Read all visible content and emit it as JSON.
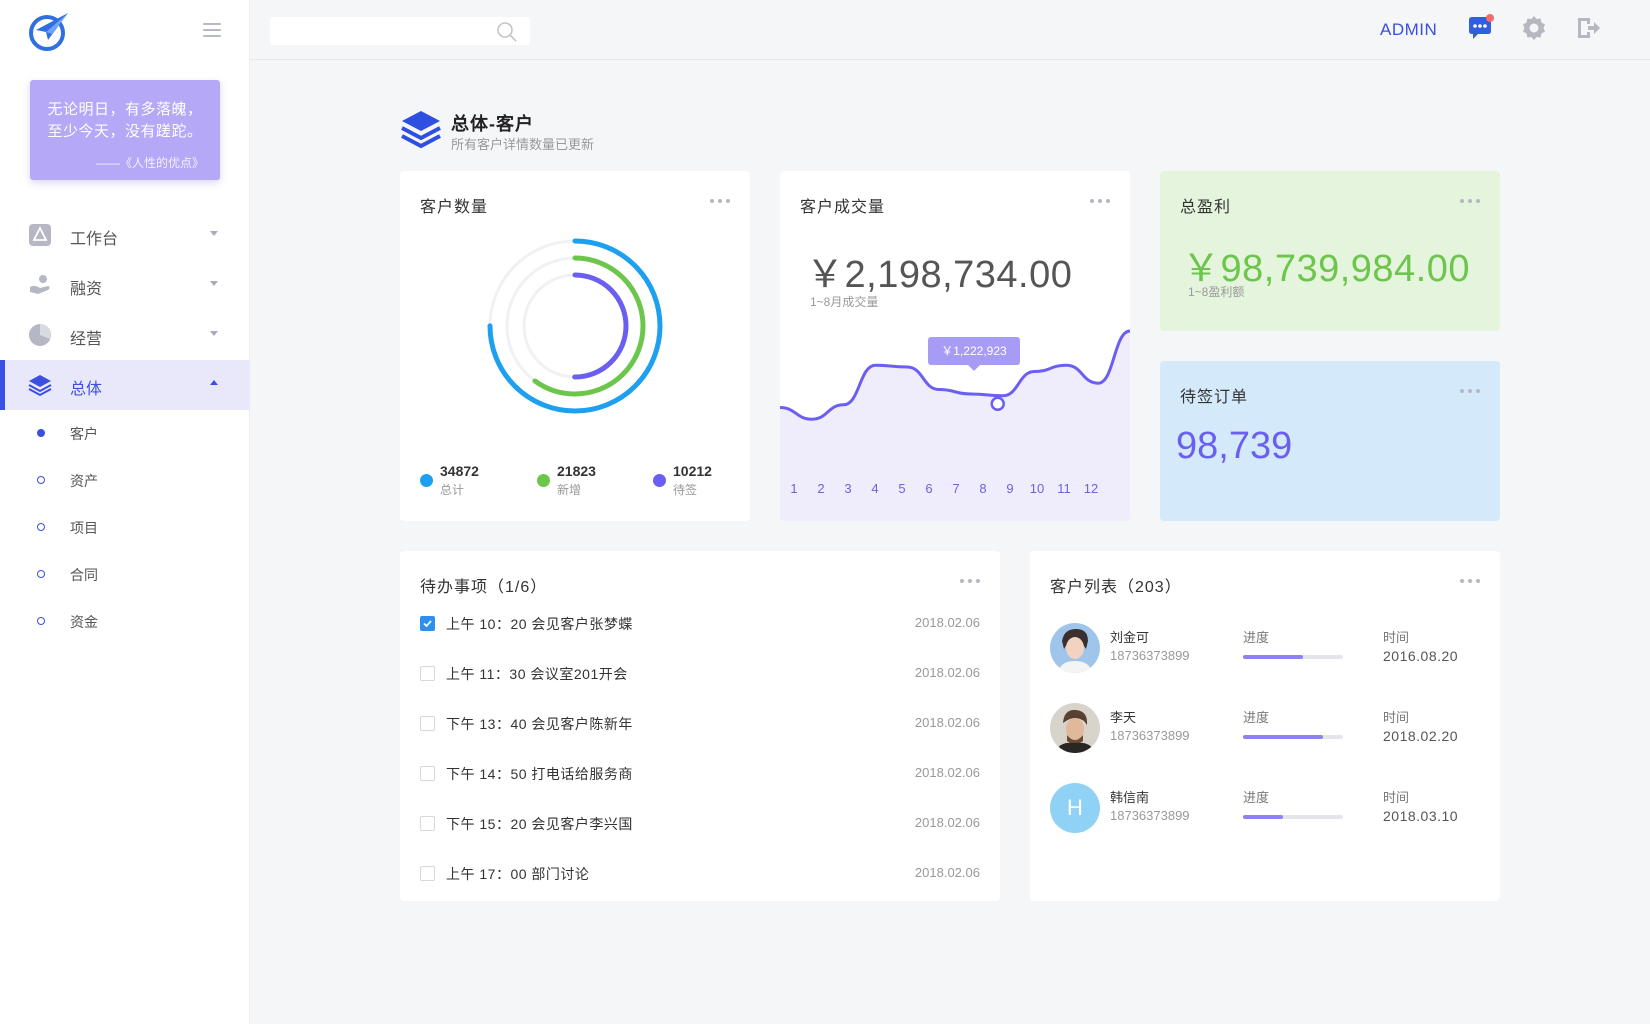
{
  "sidebar": {
    "quote": {
      "line1": "无论明日，有多落魄，",
      "line2": "至少今天，没有蹉跎。",
      "source": "——《人性的优点》"
    },
    "nav": [
      {
        "label": "工作台",
        "icon": "workbench-icon"
      },
      {
        "label": "融资",
        "icon": "financing-icon"
      },
      {
        "label": "经营",
        "icon": "pie-chart-icon"
      },
      {
        "label": "总体",
        "icon": "layers-icon",
        "active": true
      }
    ],
    "sub": [
      {
        "label": "客户",
        "active": true
      },
      {
        "label": "资产"
      },
      {
        "label": "项目"
      },
      {
        "label": "合同"
      },
      {
        "label": "资金"
      }
    ]
  },
  "topbar": {
    "search_value": "",
    "user": "ADMIN"
  },
  "page": {
    "title": "总体-客户",
    "subtitle": "所有客户详情数量已更新"
  },
  "customer_count": {
    "title": "客户数量",
    "stats": [
      {
        "value": "34872",
        "label": "总计",
        "color": "#1ea0f0",
        "ratio": 1.0
      },
      {
        "value": "21823",
        "label": "新增",
        "color": "#6cc64c",
        "ratio": 0.63
      },
      {
        "value": "10212",
        "label": "待签",
        "color": "#6a5ff0",
        "ratio": 0.5
      }
    ]
  },
  "deals": {
    "title": "客户成交量",
    "amount": "￥2,198,734.00",
    "caption": "1~8月成交量",
    "tooltip": "￥1,222,923",
    "highlight_month": 8
  },
  "profit": {
    "title": "总盈利",
    "amount": "￥98,739,984.00",
    "caption": "1~8盈利额",
    "color": "#6cc64c"
  },
  "pending": {
    "title": "待签订单",
    "value": "98,739",
    "color": "#6a5ff0"
  },
  "todo": {
    "title": "待办事项（1/6）",
    "items": [
      {
        "text": "上午 10：20 会见客户张梦蝶",
        "date": "2018.02.06",
        "done": true
      },
      {
        "text": "上午 11：30 会议室201开会",
        "date": "2018.02.06",
        "done": false
      },
      {
        "text": "下午 13：40 会见客户陈新年",
        "date": "2018.02.06",
        "done": false
      },
      {
        "text": "下午 14：50 打电话给服务商",
        "date": "2018.02.06",
        "done": false
      },
      {
        "text": "下午 15：20 会见客户李兴国",
        "date": "2018.02.06",
        "done": false
      },
      {
        "text": "上午 17：00 部门讨论",
        "date": "2018.02.06",
        "done": false
      }
    ]
  },
  "customers": {
    "title": "客户列表（203）",
    "progress_label": "进度",
    "time_label": "时间",
    "rows": [
      {
        "name": "刘金可",
        "phone": "18736373899",
        "progress": 0.6,
        "time": "2016.08.20",
        "avatar": "photo"
      },
      {
        "name": "李天",
        "phone": "18736373899",
        "progress": 0.8,
        "time": "2018.02.20",
        "avatar": "photo"
      },
      {
        "name": "韩信南",
        "phone": "18736373899",
        "progress": 0.4,
        "time": "2018.03.10",
        "avatar": "H"
      }
    ]
  },
  "chart_data": {
    "type": "line",
    "x": [
      1,
      2,
      3,
      4,
      5,
      6,
      7,
      8,
      9,
      10,
      11,
      12
    ],
    "values": [
      0.15,
      0.02,
      0.18,
      0.62,
      0.6,
      0.35,
      0.3,
      0.28,
      0.55,
      0.62,
      0.42,
      1.0
    ],
    "title": "",
    "xlabel": "",
    "ylabel": ""
  }
}
